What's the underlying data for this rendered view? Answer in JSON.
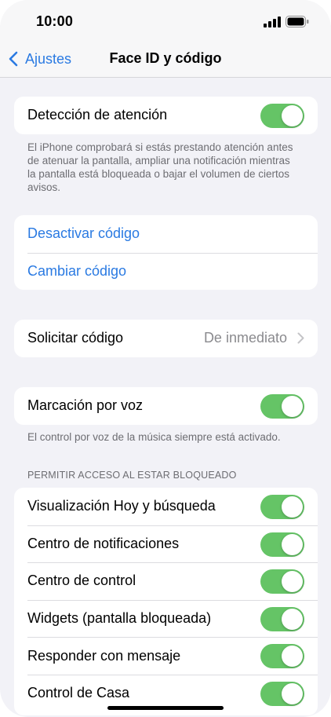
{
  "status": {
    "time": "10:00"
  },
  "nav": {
    "back_label": "Ajustes",
    "title": "Face ID y código"
  },
  "attention": {
    "label": "Detección de atención",
    "on": true,
    "footnote": "El iPhone comprobará si estás prestando atención antes de atenuar la pantalla, ampliar una notificación mientras la pantalla está bloqueada o bajar el volumen de ciertos avisos."
  },
  "passcode": {
    "disable_label": "Desactivar código",
    "change_label": "Cambiar código"
  },
  "require": {
    "label": "Solicitar código",
    "value": "De inmediato"
  },
  "voice_dial": {
    "label": "Marcación por voz",
    "on": true,
    "footnote": "El control por voz de la música siempre está activado."
  },
  "locked_access": {
    "header": "PERMITIR ACCESO AL ESTAR BLOQUEADO",
    "items": [
      {
        "label": "Visualización Hoy y búsqueda",
        "on": true
      },
      {
        "label": "Centro de notificaciones",
        "on": true
      },
      {
        "label": "Centro de control",
        "on": true
      },
      {
        "label": "Widgets (pantalla bloqueada)",
        "on": true
      },
      {
        "label": "Responder con mensaje",
        "on": true
      },
      {
        "label": "Control de Casa",
        "on": true
      }
    ]
  },
  "colors": {
    "accent": "#2a7ae2",
    "toggle_on": "#65c466",
    "background": "#f2f2f7"
  }
}
